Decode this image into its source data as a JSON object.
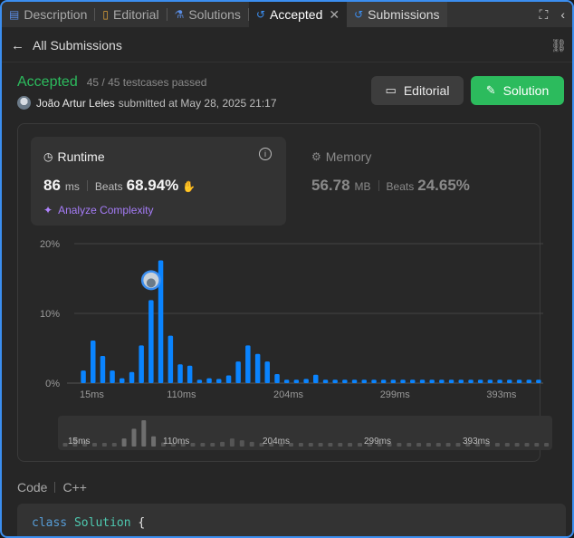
{
  "tabs": [
    {
      "label": "Description",
      "icon": "description-icon",
      "glyph": "▤"
    },
    {
      "label": "Editorial",
      "icon": "book-icon",
      "glyph": "📖"
    },
    {
      "label": "Solutions",
      "icon": "flask-icon",
      "glyph": "⚗"
    },
    {
      "label": "Accepted",
      "icon": "history-icon",
      "glyph": "↺",
      "close": "✕"
    },
    {
      "label": "Submissions",
      "icon": "history-icon",
      "glyph": "↺"
    }
  ],
  "toolbar": {
    "maximize_glyph": "⛶",
    "collapse_glyph": "‹"
  },
  "subnav": {
    "back_glyph": "←",
    "label": "All Submissions",
    "link_glyph": "🔗"
  },
  "submission": {
    "status": "Accepted",
    "testcases": "45 / 45 testcases passed",
    "author": "João Artur Leles",
    "submitted_text": "submitted at May 28, 2025 21:17"
  },
  "buttons": {
    "editorial": "Editorial",
    "solution": "Solution"
  },
  "runtime": {
    "title": "Runtime",
    "value": "86",
    "unit": "ms",
    "beats_label": "Beats",
    "beats_value": "68.94%",
    "analyze": "Analyze Complexity"
  },
  "memory": {
    "title": "Memory",
    "value": "56.78",
    "unit": "MB",
    "beats_label": "Beats",
    "beats_value": "24.65%"
  },
  "colors": {
    "accent": "#2cbb5d",
    "bar": "#0a84ff",
    "bar_dim": "#5a5a5a",
    "purple": "#a57cf7"
  },
  "chart_data": {
    "type": "bar",
    "title": "",
    "xlabel": "",
    "ylabel": "",
    "ylim": [
      0,
      20
    ],
    "yticks": [
      "20%",
      "10%",
      "0%"
    ],
    "xticks": [
      "15ms",
      "110ms",
      "204ms",
      "299ms",
      "393ms"
    ],
    "marker_index": 8,
    "values": [
      1.8,
      6.1,
      3.9,
      1.8,
      0.7,
      1.6,
      5.4,
      11.9,
      17.6,
      6.8,
      2.7,
      2.5,
      0.5,
      0.7,
      0.6,
      1.1,
      3.1,
      5.4,
      4.2,
      3.1,
      1.3,
      0.5,
      0.5,
      0.6,
      1.2,
      0.5,
      0.5,
      0.5,
      0.5,
      0.5,
      0.5,
      0.5,
      0.5,
      0.5,
      0.5,
      0.5,
      0.5,
      0.5,
      0.5,
      0.5,
      0.5,
      0.5,
      0.5,
      0.5,
      0.5,
      0.5,
      0.5,
      0.5,
      0.5,
      0.5
    ]
  },
  "code": {
    "label": "Code",
    "language": "C++",
    "kw": "class",
    "name": "Solution",
    "brace": "{"
  }
}
